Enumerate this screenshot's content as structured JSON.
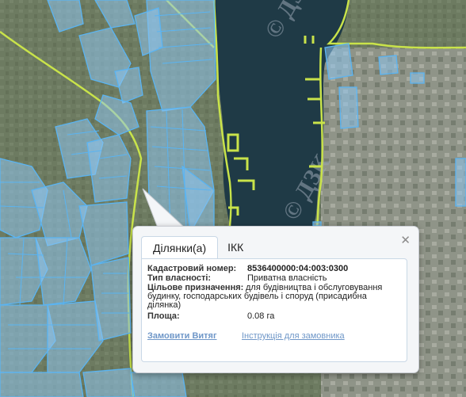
{
  "popup": {
    "tabs": [
      {
        "label": "Ділянки(а)",
        "active": true
      },
      {
        "label": "ІКК",
        "active": false
      }
    ],
    "close_icon": "close-x-icon",
    "fields": {
      "cadastral_label": "Кадастровий номер:",
      "cadastral_value": "8536400000:04:003:0300",
      "ownership_label": "Тип власності:",
      "ownership_value": "Приватна власність",
      "purpose_label": "Цільове призначення:",
      "purpose_value_first": "для будівництва і обслуговування",
      "purpose_value_rest": "будинку, господарських будівель і споруд (присадибна ділянка)",
      "area_label": "Площа:",
      "area_value": "0.08 га"
    },
    "links": {
      "order_extract": "Замовити Витяг",
      "instructions": "Інструкція для замовника"
    }
  },
  "map": {
    "watermark": "© ДЗК",
    "colors": {
      "parcel_fill": "#8ec5ee",
      "parcel_stroke": "#5ab4f2",
      "boundary_line": "#c9e34a",
      "water": "#1f3a46"
    }
  }
}
